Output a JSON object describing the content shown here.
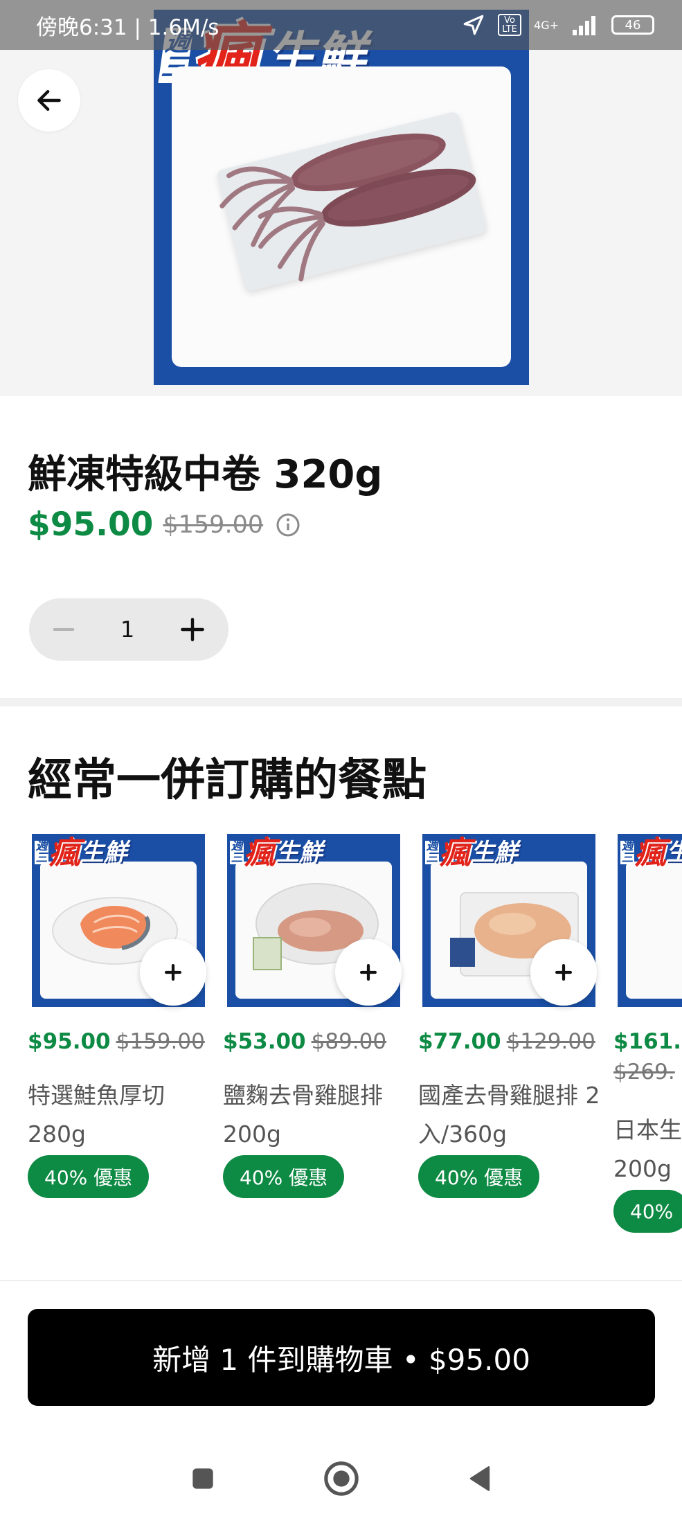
{
  "status_bar": {
    "left_text": "傍晚6:31 | 1.6M/s",
    "network": "4G+",
    "volte": "Vo LTE",
    "battery": "46"
  },
  "hero": {
    "banner_week": "週三",
    "banner_crazy": "瘋",
    "banner_fresh": "生鮮",
    "brand_blue": "#1a4fa5",
    "brand_red": "#e2231a"
  },
  "product": {
    "title": "鮮凍特級中卷 320g",
    "price": "$95.00",
    "original_price": "$159.00",
    "quantity": "1"
  },
  "section": {
    "title": "經常一併訂購的餐點"
  },
  "items": [
    {
      "price": "$95.00",
      "original_price": "$159.00",
      "name": "特選鮭魚厚切 280g",
      "badge": "40% 優惠"
    },
    {
      "price": "$53.00",
      "original_price": "$89.00",
      "name": "鹽麴去骨雞腿排 200g",
      "badge": "40% 優惠"
    },
    {
      "price": "$77.00",
      "original_price": "$129.00",
      "name": "國產去骨雞腿排 2入/360g",
      "badge": "40% 優惠"
    },
    {
      "price": "$161.",
      "original_price": "$269.",
      "name": "日本生 200g",
      "badge": "40%"
    }
  ],
  "cta": {
    "label": "新增 1 件到購物車 • $95.00"
  },
  "colors": {
    "accent_green": "#0d8a43",
    "cta_black": "#000000"
  }
}
